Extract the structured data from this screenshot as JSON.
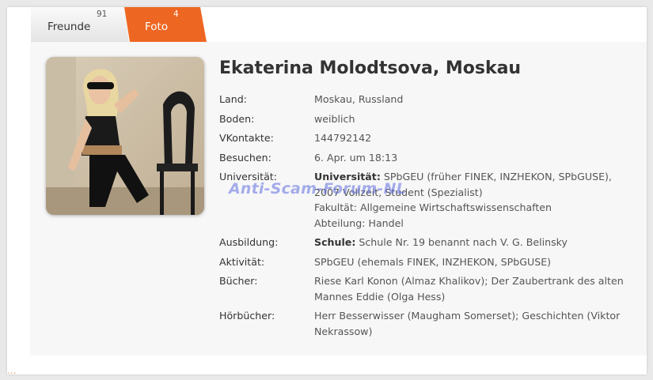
{
  "tabs": [
    {
      "label": "Freunde",
      "count": "91"
    },
    {
      "label": "Foto",
      "count": "4"
    }
  ],
  "profile": {
    "name": "Ekaterina Molodtsova, Moskau",
    "rows": [
      {
        "label": "Land:",
        "value": "Moskau, Russland"
      },
      {
        "label": "Boden:",
        "value": "weiblich"
      },
      {
        "label": "VKontakte:",
        "value": "144792142"
      },
      {
        "label": "Besuchen:",
        "value": "6. Apr. um 18:13"
      },
      {
        "label": "Universität:",
        "prefix": "Universität:",
        "value": "SPbGEU (früher FINEK, INZHEKON, SPbGUSE), 2007 Vollzeit, Student (Spezialist)",
        "extra1": "Fakultät: Allgemeine Wirtschaftswissenschaften",
        "extra2": "Abteilung: Handel"
      },
      {
        "label": "Ausbildung:",
        "prefix": "Schule:",
        "value": "Schule Nr. 19 benannt nach V. G. Belinsky"
      },
      {
        "label": "Aktivität:",
        "value": "SPbGEU (ehemals FINEK, INZHEKON, SPbGUSE)"
      },
      {
        "label": "Bücher:",
        "value": "Riese Karl Konon (Almaz Khalikov); Der Zaubertrank des alten Mannes Eddie (Olga Hess)"
      },
      {
        "label": "Hörbücher:",
        "value": "Herr Besserwisser (Maugham Somerset); Geschichten (Viktor Nekrassow)"
      }
    ]
  },
  "watermark": "Anti-Scam-Forum-NL",
  "footer_mark": "...",
  "colors": {
    "accent": "#ee6722"
  }
}
